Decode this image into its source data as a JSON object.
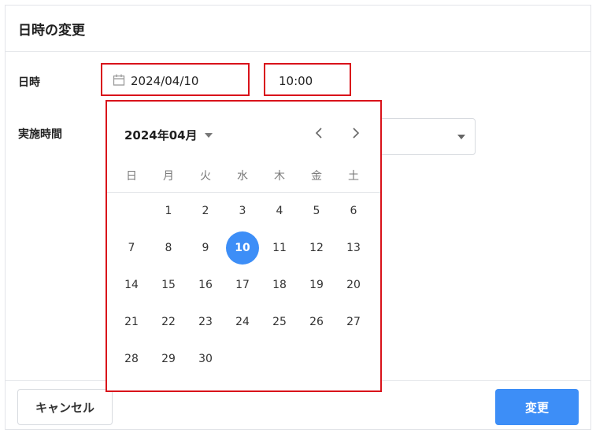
{
  "dialog": {
    "title": "日時の変更",
    "datetime_label": "日時",
    "duration_label": "実施時間",
    "date_value": "2024/04/10",
    "time_value": "10:00",
    "cancel_label": "キャンセル",
    "submit_label": "変更"
  },
  "icons": {
    "date_field": "calendar-icon",
    "duration_select": "caret-down-icon",
    "month_selector": "caret-down-icon",
    "prev_month": "chevron-left-icon",
    "next_month": "chevron-right-icon"
  },
  "colors": {
    "accent": "#3d8ef7",
    "highlight_border": "#d9121a"
  },
  "calendar": {
    "month_label": "2024年04月",
    "weekdays": [
      "日",
      "月",
      "火",
      "水",
      "木",
      "金",
      "土"
    ],
    "selected_day": 10,
    "weeks": [
      [
        "",
        "1",
        "2",
        "3",
        "4",
        "5",
        "6"
      ],
      [
        "7",
        "8",
        "9",
        "10",
        "11",
        "12",
        "13"
      ],
      [
        "14",
        "15",
        "16",
        "17",
        "18",
        "19",
        "20"
      ],
      [
        "21",
        "22",
        "23",
        "24",
        "25",
        "26",
        "27"
      ],
      [
        "28",
        "29",
        "30",
        "",
        "",
        "",
        ""
      ]
    ]
  }
}
